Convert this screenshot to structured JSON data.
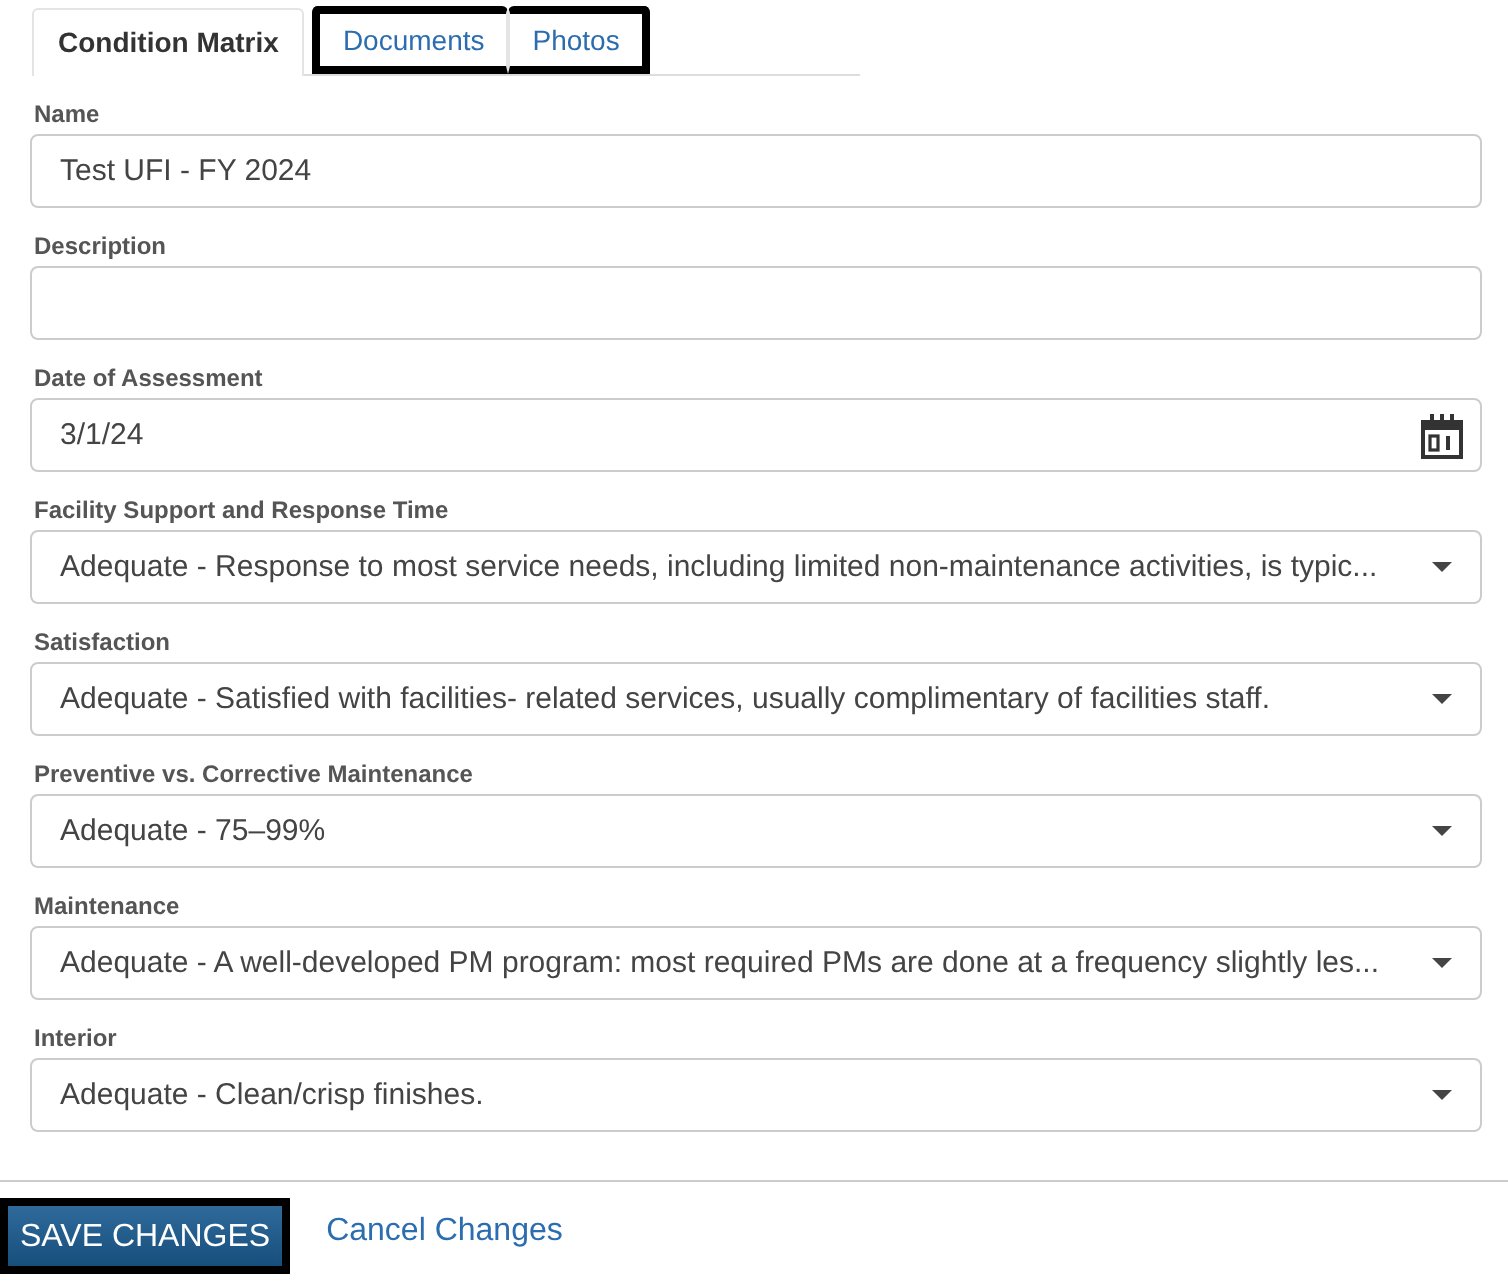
{
  "tabs": [
    {
      "label": "Condition Matrix",
      "selected": true
    },
    {
      "label": "Documents",
      "selected": false
    },
    {
      "label": "Photos",
      "selected": false
    }
  ],
  "fields": [
    {
      "label": "Name",
      "kind": "text",
      "value": "Test UFI - FY 2024"
    },
    {
      "label": "Description",
      "kind": "text"
    },
    {
      "label": "Date of Assessment",
      "kind": "date",
      "value": "3/1/24"
    },
    {
      "label": "Facility Support and Response Time",
      "kind": "select",
      "value": "Adequate - Response to most service needs, including limited non-maintenance activities, is typic..."
    },
    {
      "label": "Satisfaction",
      "kind": "select",
      "value": "Adequate - Satisfied with facilities- related services, usually complimentary of facilities staff."
    },
    {
      "label": "Preventive vs. Corrective Maintenance",
      "kind": "select",
      "value": "Adequate - 75–99%"
    },
    {
      "label": "Maintenance",
      "kind": "select",
      "value": "Adequate - A well-developed PM program: most required PMs are done at a frequency slightly les..."
    },
    {
      "label": "Interior",
      "kind": "select",
      "value": "Adequate - Clean/crisp finishes."
    }
  ],
  "footer": {
    "save": "SAVE CHANGES",
    "cancel": "Cancel Changes"
  }
}
